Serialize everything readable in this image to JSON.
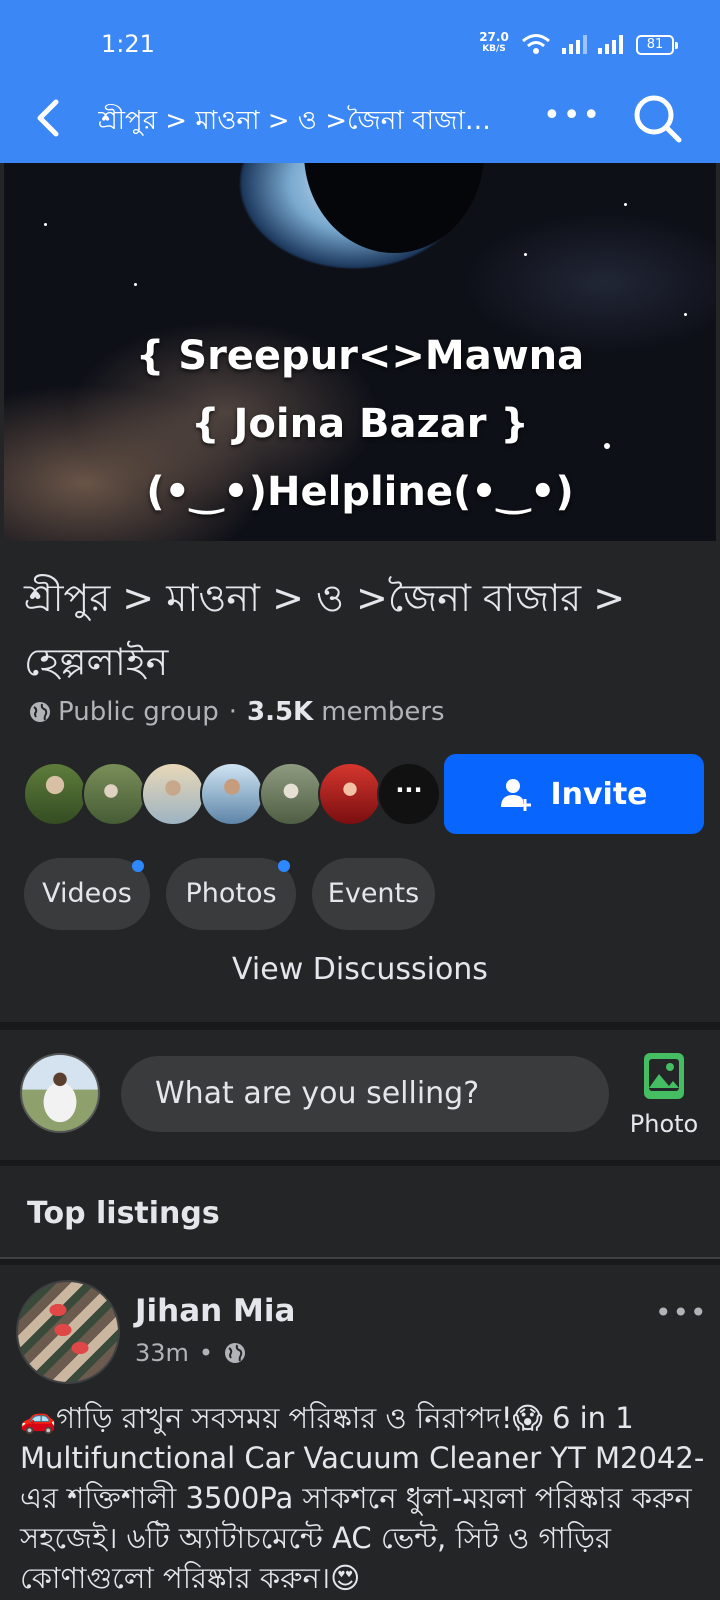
{
  "status_bar": {
    "time": "1:21",
    "net_speed": "27.0",
    "net_unit": "KB/S",
    "battery": "81"
  },
  "navbar": {
    "title": "শ্রীপুর > মাওনা > ও >জৈনা বাজার > হেল্পলাইন",
    "back_icon": "back-arrow-icon",
    "more_icon": "more-dots-icon",
    "search_icon": "search-icon"
  },
  "cover": {
    "line1": "{ Sreepur<>Mawna",
    "line2": "{ Joina Bazar }",
    "line3": "(•‿•)Helpline(•‿•)"
  },
  "group": {
    "title": "শ্রীপুর > মাওনা > ও >জৈনা বাজার > হেল্পলাইন",
    "privacy": "Public group",
    "separator": "·",
    "member_count": "3.5K",
    "members_label": "members",
    "more_members": "···",
    "invite_label": "Invite"
  },
  "chips": [
    {
      "label": "Videos"
    },
    {
      "label": "Photos"
    },
    {
      "label": "Events"
    }
  ],
  "view_discussions": "View Discussions",
  "composer": {
    "placeholder": "What are you selling?",
    "photo_label": "Photo"
  },
  "section_title": "Top listings",
  "post": {
    "author": "Jihan Mia",
    "time": "33m",
    "dot": "•",
    "more": "•••",
    "text": "🚗গাড়ি রাখুন সবসময় পরিষ্কার ও নিরাপদ!😱 6 in 1 Multifunctional Car Vacuum Cleaner YT M2042-এর শক্তিশালী 3500Pa সাকশনে ধুলা-ময়লা পরিষ্কার করুন সহজেই। ৬টি অ্যাটাচমেন্টে AC ভেন্ট, সিট ও গাড়ির কোণাগুলো পরিষ্কার করুন।😍"
  },
  "colors": {
    "topbar": "#3b87f5",
    "background": "#242526",
    "accent": "#0866ff",
    "photo_icon": "#45bd62"
  }
}
